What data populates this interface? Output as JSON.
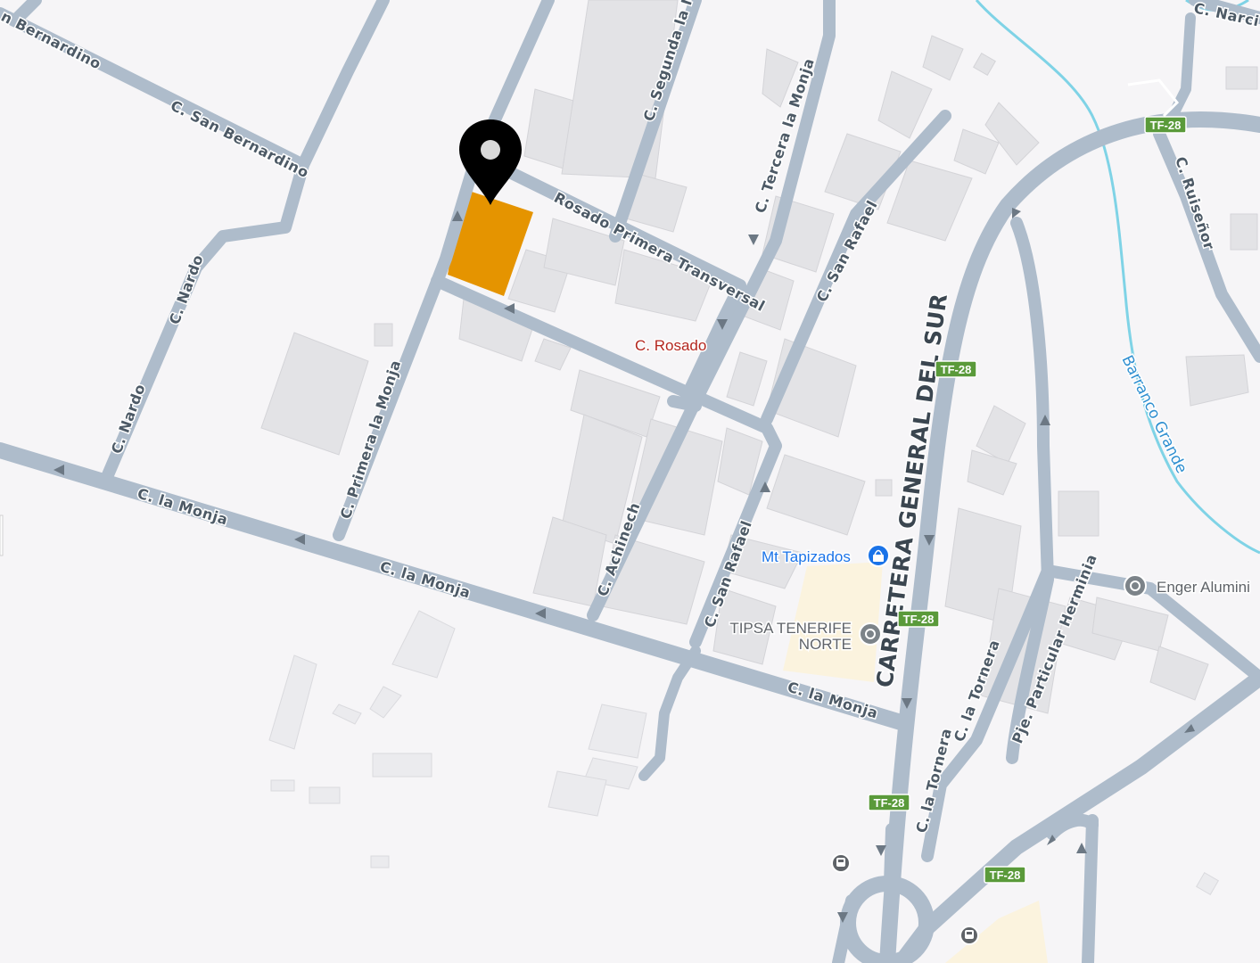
{
  "map": {
    "streets": {
      "san_bernardino_1": "n Bernardino",
      "san_bernardino_2": "C. San Bernardino",
      "nardo_1": "C. Nardo",
      "nardo_2": "C. Nardo",
      "la_monja_1": "C. la Monja",
      "la_monja_2": "C. la Monja",
      "la_monja_3": "C. la Monja",
      "primera_la_monja": "C. Primera la Monja",
      "segunda_la_monja": "C. Segunda la M",
      "tercera_la_monja": "C. Tercera la Monja",
      "rosado_primera_transversal": "Rosado Primera Transversal",
      "san_rafael_1": "C. San Rafael",
      "san_rafael_2": "C. San Rafael",
      "achinech": "C. Achinech",
      "carretera_general_del_sur": "CARRETERA GENERAL DEL SUR",
      "la_tornera_1": "C. la Tornera",
      "la_tornera_2": "C. la Tornera",
      "pje_particular_herminia": "Pje. Particular Herminia",
      "ruisenor": "C. Ruiseñor",
      "narci": "C. Narci"
    },
    "places": {
      "c_rosado": "C. Rosado",
      "mt_tapizados": "Mt Tapizados",
      "tipsa_line1": "TIPSA TENERIFE",
      "tipsa_line2": "NORTE",
      "enger": "Enger Alumini"
    },
    "waterway": "Barranco Grande",
    "highway_shields": [
      "TF-28",
      "TF-28",
      "TF-28",
      "TF-28",
      "TF-28"
    ],
    "colors": {
      "background": "#f6f5f7",
      "road": "#aebccb",
      "highlighted_parcel": "#e59400",
      "pin": "#000000",
      "shield": "#5a9a3a",
      "river": "#7fd3e6"
    },
    "icons": [
      "location-pin-icon",
      "shopping-bag-icon",
      "poi-icon",
      "bus-stop-icon"
    ]
  }
}
